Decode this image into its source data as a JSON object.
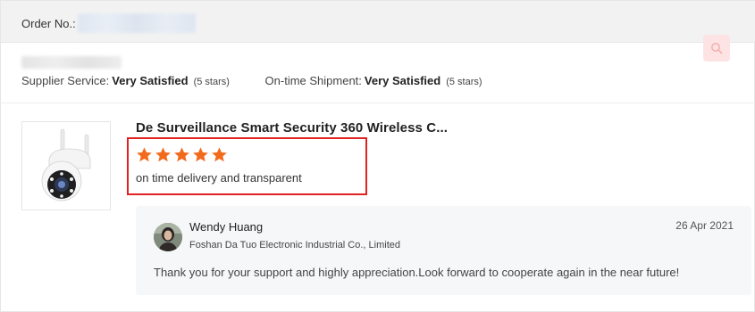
{
  "order": {
    "label": "Order No.:"
  },
  "ratings": {
    "supplier_service_label": "Supplier Service:",
    "supplier_service_value": "Very Satisfied",
    "supplier_service_stars": "(5 stars)",
    "shipment_label": "On-time Shipment:",
    "shipment_value": "Very Satisfied",
    "shipment_stars": "(5 stars)"
  },
  "product": {
    "title": "De Surveillance Smart Security 360 Wireless C...",
    "thumbnail_icon": "security-camera-image"
  },
  "review": {
    "rating": 5,
    "text": "on time delivery and transparent",
    "star_color": "#f26b1d",
    "highlight_color": "#e02222"
  },
  "reply": {
    "name": "Wendy Huang",
    "company": "Foshan Da Tuo Electronic Industrial Co., Limited",
    "date": "26 Apr 2021",
    "text": "Thank you for your support and highly appreciation.Look forward to cooperate again in the near future!"
  },
  "actions": {
    "translate_icon": "translate-icon"
  }
}
